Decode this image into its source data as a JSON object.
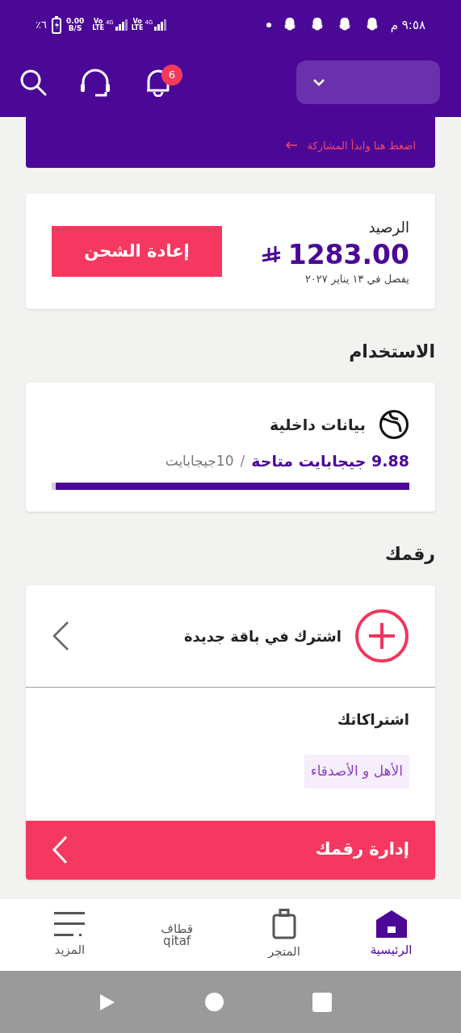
{
  "status_bar": {
    "time": "٩:٥٨ م",
    "battery": "٪٦",
    "speed_value": "0.00",
    "speed_unit": "B/S",
    "sims": [
      {
        "vo": "Vo",
        "lte": "LTE",
        "net": "4G"
      },
      {
        "vo": "Vo",
        "lte": "LTE",
        "net": "4G"
      }
    ]
  },
  "header": {
    "notification_count": "6"
  },
  "banner": {
    "link": "اضغط هنا وابدأ المشاركة"
  },
  "balance": {
    "label": "الرصيد",
    "amount": "1283.00",
    "expiry": "يفصل في ١٣ يناير ٢٠٢٧",
    "button": "إعادة الشحن"
  },
  "usage": {
    "heading": "الاستخدام",
    "title": "بيانات داخلية",
    "available": "9.88 جيجابايت متاحة",
    "separator": "/",
    "total": "10جيجابايت",
    "level": 0.988
  },
  "number": {
    "heading": "رقمك",
    "subscribe": "اشترك في باقة جديدة",
    "subscriptions_title": "اشتراكاتك",
    "subscriptions": [
      "الأهل و الأصدقاء"
    ],
    "manage": "إدارة رقمك"
  },
  "bottom_nav": [
    {
      "kind": "home",
      "label": "الرئيسية",
      "selected": true
    },
    {
      "kind": "store",
      "label": "المتجر",
      "selected": false
    },
    {
      "kind": "qitaf",
      "label": "قطاف",
      "sublabel": "qitaf",
      "selected": false
    },
    {
      "kind": "more",
      "label": "المزيد",
      "selected": false
    }
  ]
}
